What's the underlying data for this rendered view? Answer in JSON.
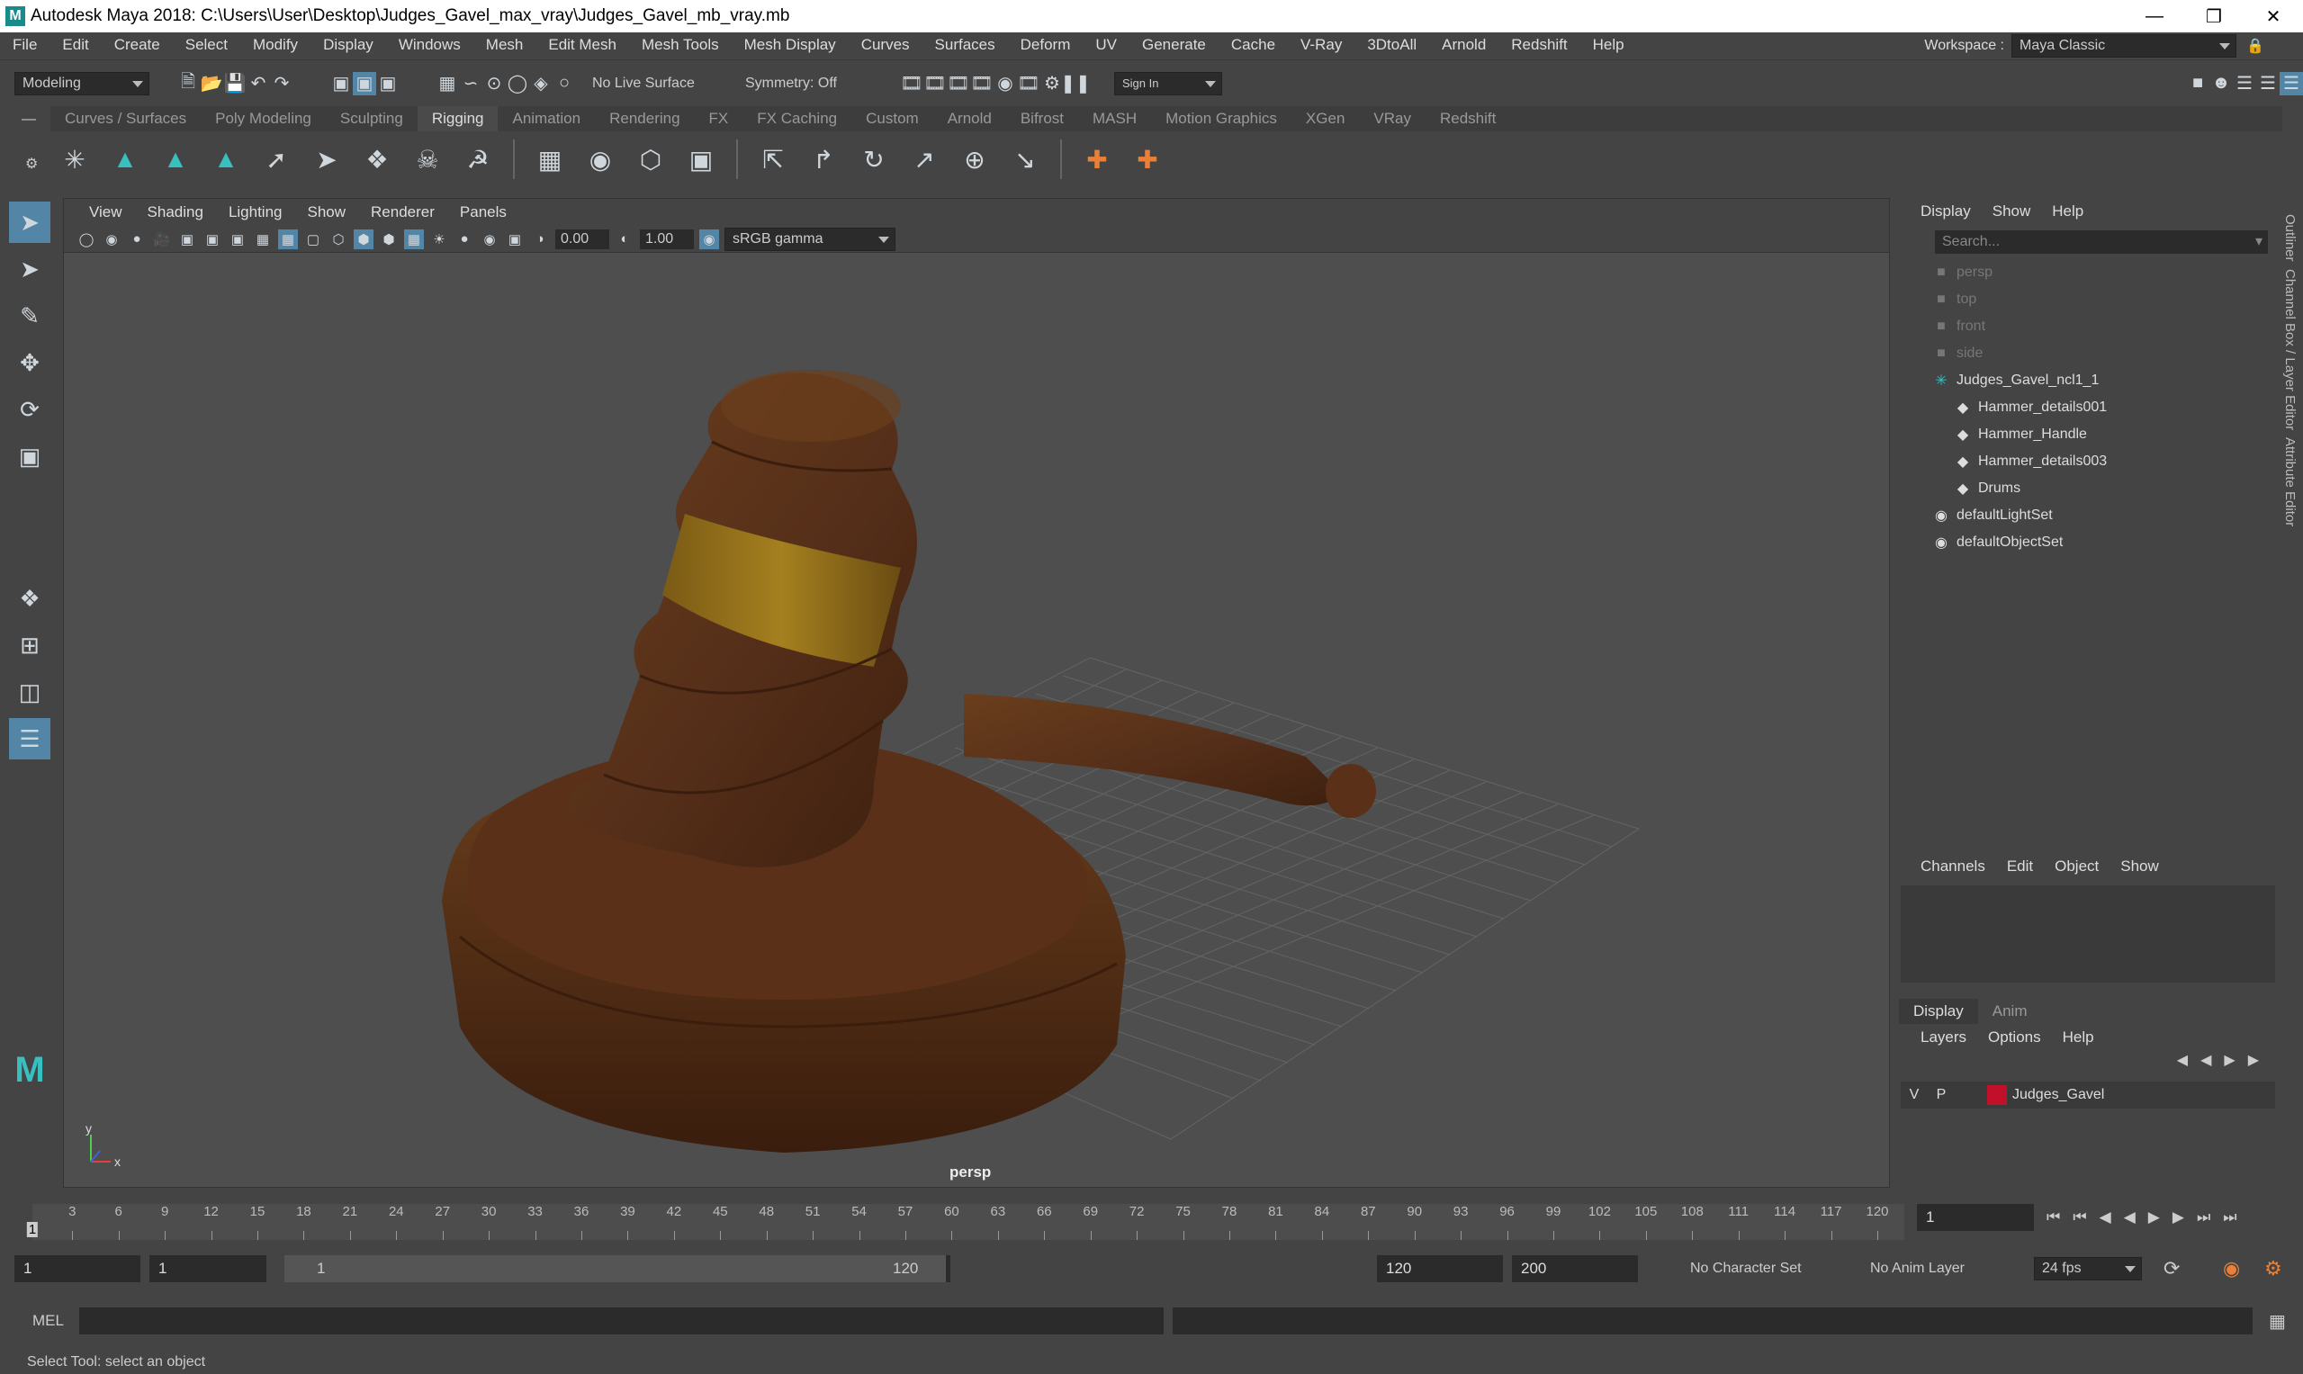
{
  "window": {
    "title": "Autodesk Maya 2018: C:\\Users\\User\\Desktop\\Judges_Gavel_max_vray\\Judges_Gavel_mb_vray.mb",
    "logo": "M"
  },
  "menubar": {
    "items": [
      "File",
      "Edit",
      "Create",
      "Select",
      "Modify",
      "Display",
      "Windows",
      "Mesh",
      "Edit Mesh",
      "Mesh Tools",
      "Mesh Display",
      "Curves",
      "Surfaces",
      "Deform",
      "UV",
      "Generate",
      "Cache",
      "V-Ray",
      "3DtoAll",
      "Arnold",
      "Redshift",
      "Help"
    ],
    "workspace_label": "Workspace :",
    "workspace_value": "Maya Classic"
  },
  "statusline": {
    "mode": "Modeling",
    "live_surface": "No Live Surface",
    "symmetry": "Symmetry: Off",
    "sign_in": "Sign In"
  },
  "shelf": {
    "tabs": [
      "Curves / Surfaces",
      "Poly Modeling",
      "Sculpting",
      "Rigging",
      "Animation",
      "Rendering",
      "FX",
      "FX Caching",
      "Custom",
      "Arnold",
      "Bifrost",
      "MASH",
      "Motion Graphics",
      "XGen",
      "VRay",
      "Redshift"
    ],
    "active_tab": "Rigging"
  },
  "viewport": {
    "menus": [
      "View",
      "Shading",
      "Lighting",
      "Show",
      "Renderer",
      "Panels"
    ],
    "exposure": "0.00",
    "gamma": "1.00",
    "colorspace": "sRGB gamma",
    "camera_label": "persp",
    "axis_x": "x",
    "axis_y": "y"
  },
  "outliner": {
    "menus": [
      "Display",
      "Show",
      "Help"
    ],
    "search_placeholder": "Search...",
    "items": [
      {
        "label": "persp",
        "dim": true,
        "icon": "camera-icon",
        "indent": 0
      },
      {
        "label": "top",
        "dim": true,
        "icon": "camera-icon",
        "indent": 0
      },
      {
        "label": "front",
        "dim": true,
        "icon": "camera-icon",
        "indent": 0
      },
      {
        "label": "side",
        "dim": true,
        "icon": "camera-icon",
        "indent": 0
      },
      {
        "label": "Judges_Gavel_ncl1_1",
        "dim": false,
        "icon": "group-icon",
        "indent": 0
      },
      {
        "label": "Hammer_details001",
        "dim": false,
        "icon": "mesh-icon",
        "indent": 1
      },
      {
        "label": "Hammer_Handle",
        "dim": false,
        "icon": "mesh-icon",
        "indent": 1
      },
      {
        "label": "Hammer_details003",
        "dim": false,
        "icon": "mesh-icon",
        "indent": 1
      },
      {
        "label": "Drums",
        "dim": false,
        "icon": "mesh-icon",
        "indent": 1
      },
      {
        "label": "defaultLightSet",
        "dim": false,
        "icon": "set-icon",
        "indent": 0
      },
      {
        "label": "defaultObjectSet",
        "dim": false,
        "icon": "set-icon",
        "indent": 0
      }
    ]
  },
  "channelbox": {
    "menus": [
      "Channels",
      "Edit",
      "Object",
      "Show"
    ]
  },
  "layers": {
    "tabs": [
      "Display",
      "Anim"
    ],
    "menus": [
      "Layers",
      "Options",
      "Help"
    ],
    "row": {
      "v": "V",
      "p": "P",
      "name": "Judges_Gavel",
      "color": "#c3102a"
    }
  },
  "sidetabs": [
    "Outliner",
    "Channel Box / Layer Editor",
    "Attribute Editor"
  ],
  "timeline": {
    "ticks": [
      3,
      6,
      9,
      12,
      15,
      18,
      21,
      24,
      27,
      30,
      33,
      36,
      39,
      42,
      45,
      48,
      51,
      54,
      57,
      60,
      63,
      66,
      69,
      72,
      75,
      78,
      81,
      84,
      87,
      90,
      93,
      96,
      99,
      102,
      105,
      108,
      111,
      114,
      117,
      120
    ],
    "current_frame": "1",
    "frame_marker": "1"
  },
  "range": {
    "start": "1",
    "playback_start": "1",
    "slider_start": "1",
    "slider_end": "120",
    "playback_end": "120",
    "end": "200",
    "character_set": "No Character Set",
    "anim_layer": "No Anim Layer",
    "fps": "24 fps"
  },
  "cmdline": {
    "label": "MEL"
  },
  "helpline": {
    "text": "Select Tool: select an object"
  }
}
